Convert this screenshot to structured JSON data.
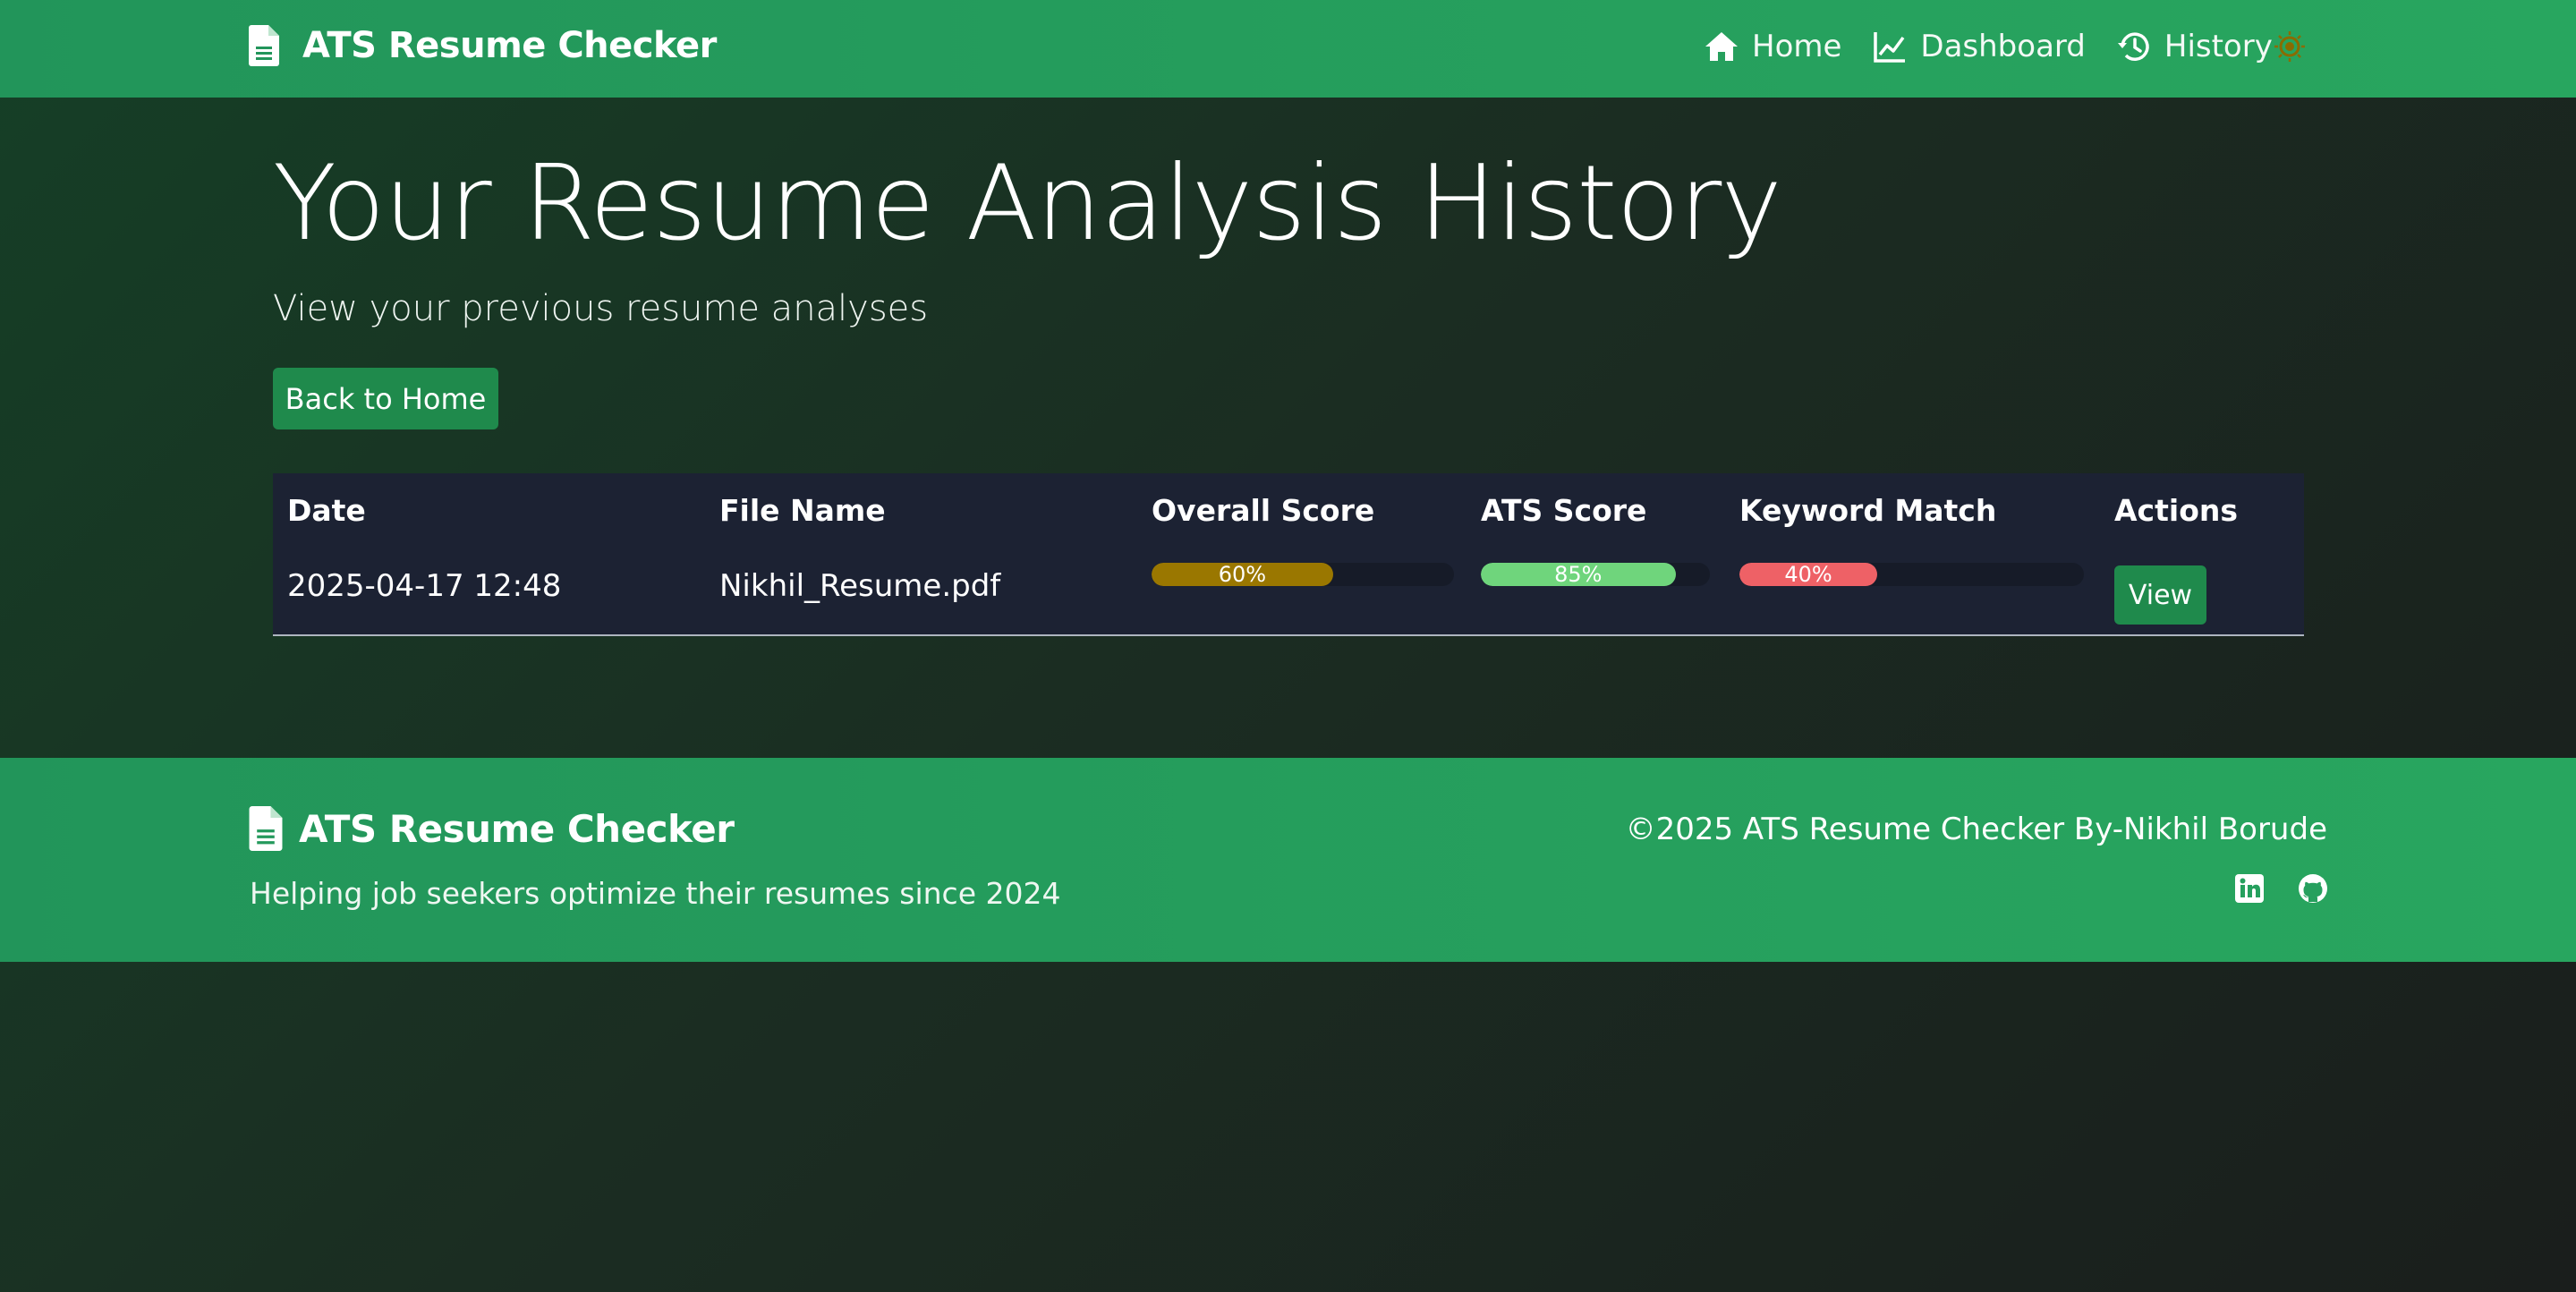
{
  "navbar": {
    "brand": "ATS Resume Checker",
    "links": [
      {
        "label": "Home",
        "icon": "home-icon"
      },
      {
        "label": "Dashboard",
        "icon": "chart-line-icon"
      },
      {
        "label": "History",
        "icon": "history-icon"
      }
    ],
    "theme_toggle_icon": "sun-icon"
  },
  "header": {
    "title": "Your Resume Analysis History",
    "subtitle": "View your previous resume analyses",
    "back_button": "Back to Home"
  },
  "table": {
    "columns": [
      "Date",
      "File Name",
      "Overall Score",
      "ATS Score",
      "Keyword Match",
      "Actions"
    ],
    "rows": [
      {
        "date": "2025-04-17 12:48",
        "file_name": "Nikhil_Resume.pdf",
        "overall_score": {
          "label": "60%",
          "value": 60,
          "color": "#9a7700"
        },
        "ats_score": {
          "label": "85%",
          "value": 85,
          "color": "#6fd57c"
        },
        "keyword_match": {
          "label": "40%",
          "value": 40,
          "color": "#ee6166"
        },
        "action": "View"
      }
    ]
  },
  "footer": {
    "brand": "ATS Resume Checker",
    "tagline": "Helping job seekers optimize their resumes since 2024",
    "copyright": "©2025 ATS Resume Checker By-Nikhil Borude",
    "social": [
      "linkedin-icon",
      "github-icon"
    ]
  },
  "colors": {
    "nav_green": "#22955a",
    "button_green": "#1f8a4c",
    "table_bg": "#1c2233",
    "theme_toggle": "#8a6b00"
  }
}
